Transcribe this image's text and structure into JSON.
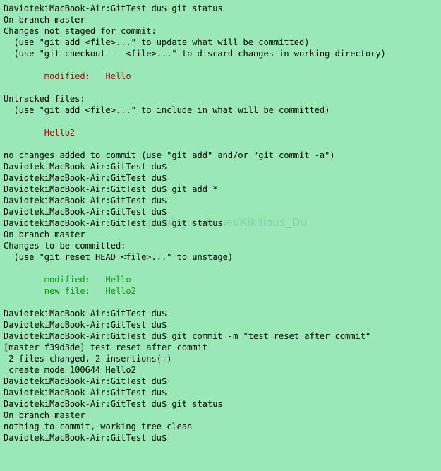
{
  "watermark": "http://blog.csdn.net/Kikitious_Du",
  "lines": [
    {
      "text": "DavidtekiMacBook-Air:GitTest du$ git status",
      "cls": ""
    },
    {
      "text": "On branch master",
      "cls": ""
    },
    {
      "text": "Changes not staged for commit:",
      "cls": ""
    },
    {
      "text": "  (use \"git add <file>...\" to update what will be committed)",
      "cls": ""
    },
    {
      "text": "  (use \"git checkout -- <file>...\" to discard changes in working directory)",
      "cls": ""
    },
    {
      "text": "",
      "cls": ""
    },
    {
      "text": "        modified:   Hello",
      "cls": "red"
    },
    {
      "text": "",
      "cls": ""
    },
    {
      "text": "Untracked files:",
      "cls": ""
    },
    {
      "text": "  (use \"git add <file>...\" to include in what will be committed)",
      "cls": ""
    },
    {
      "text": "",
      "cls": ""
    },
    {
      "text": "        Hello2",
      "cls": "red"
    },
    {
      "text": "",
      "cls": ""
    },
    {
      "text": "no changes added to commit (use \"git add\" and/or \"git commit -a\")",
      "cls": ""
    },
    {
      "text": "DavidtekiMacBook-Air:GitTest du$",
      "cls": ""
    },
    {
      "text": "DavidtekiMacBook-Air:GitTest du$",
      "cls": ""
    },
    {
      "text": "DavidtekiMacBook-Air:GitTest du$ git add *",
      "cls": ""
    },
    {
      "text": "DavidtekiMacBook-Air:GitTest du$",
      "cls": ""
    },
    {
      "text": "DavidtekiMacBook-Air:GitTest du$",
      "cls": ""
    },
    {
      "text": "DavidtekiMacBook-Air:GitTest du$ git status",
      "cls": ""
    },
    {
      "text": "On branch master",
      "cls": ""
    },
    {
      "text": "Changes to be committed:",
      "cls": ""
    },
    {
      "text": "  (use \"git reset HEAD <file>...\" to unstage)",
      "cls": ""
    },
    {
      "text": "",
      "cls": ""
    },
    {
      "text": "        modified:   Hello",
      "cls": "green"
    },
    {
      "text": "        new file:   Hello2",
      "cls": "green"
    },
    {
      "text": "",
      "cls": ""
    },
    {
      "text": "DavidtekiMacBook-Air:GitTest du$",
      "cls": ""
    },
    {
      "text": "DavidtekiMacBook-Air:GitTest du$",
      "cls": ""
    },
    {
      "text": "DavidtekiMacBook-Air:GitTest du$ git commit -m \"test reset after commit\"",
      "cls": ""
    },
    {
      "text": "[master f39d3de] test reset after commit",
      "cls": ""
    },
    {
      "text": " 2 files changed, 2 insertions(+)",
      "cls": ""
    },
    {
      "text": " create mode 100644 Hello2",
      "cls": ""
    },
    {
      "text": "DavidtekiMacBook-Air:GitTest du$",
      "cls": ""
    },
    {
      "text": "DavidtekiMacBook-Air:GitTest du$",
      "cls": ""
    },
    {
      "text": "DavidtekiMacBook-Air:GitTest du$ git status",
      "cls": ""
    },
    {
      "text": "On branch master",
      "cls": ""
    },
    {
      "text": "nothing to commit, working tree clean",
      "cls": ""
    },
    {
      "text": "DavidtekiMacBook-Air:GitTest du$",
      "cls": ""
    }
  ]
}
